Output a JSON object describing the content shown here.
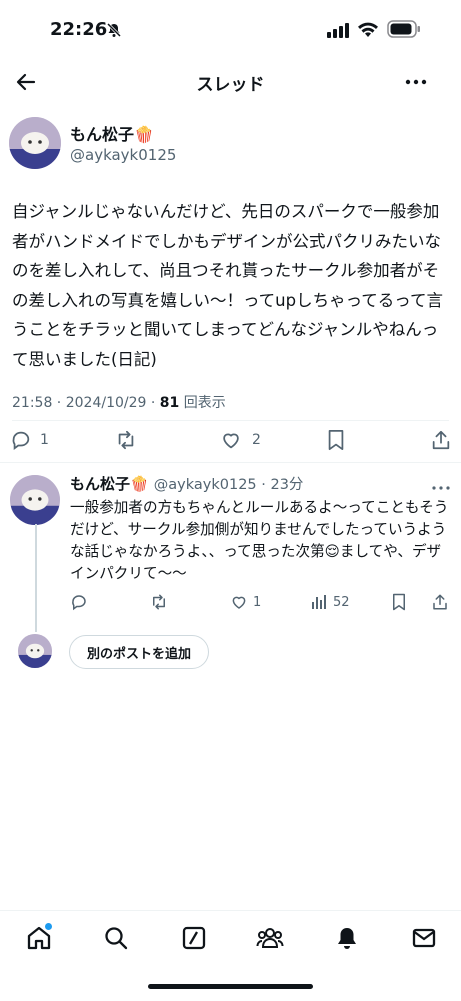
{
  "status_bar": {
    "time": "22:26"
  },
  "header": {
    "title": "スレッド"
  },
  "post": {
    "author_name": "もん松子🍿",
    "author_handle": "@aykayk0125",
    "text": "自ジャンルじゃないんだけど、先日のスパークで一般参加者がハンドメイドでしかもデザインが公式パクリみたいなのを差し入れして、尚且つそれ貰ったサークル参加者がその差し入れの写真を嬉しい〜！ってupしちゃってるって言うことをチラッと聞いてしまってどんなジャンルやねんって思いました(日記)",
    "time": "21:58",
    "date": "2024/10/29",
    "views_count": "81",
    "views_label": "回表示",
    "reply_count": "1",
    "like_count": "2"
  },
  "reply": {
    "author_name": "もん松子🍿",
    "author_handle": "@aykayk0125",
    "age": "23分",
    "text": "一般参加者の方もちゃんとルールあるよ〜ってこともそうだけど、サークル参加側が知りませんでしたっていうような話じゃなかろうよ、、って思った次第😌ましてや、デザインパクリて〜〜",
    "like_count": "1",
    "views_count": "52"
  },
  "compose": {
    "add_post_label": "別のポストを追加"
  },
  "colors": {
    "accent": "#1d9bf0",
    "text": "#0f1419",
    "muted": "#536471"
  },
  "tabbar": {
    "icons": [
      "home-icon",
      "search-icon",
      "grok-icon",
      "communities-icon",
      "notifications-icon",
      "messages-icon"
    ]
  }
}
